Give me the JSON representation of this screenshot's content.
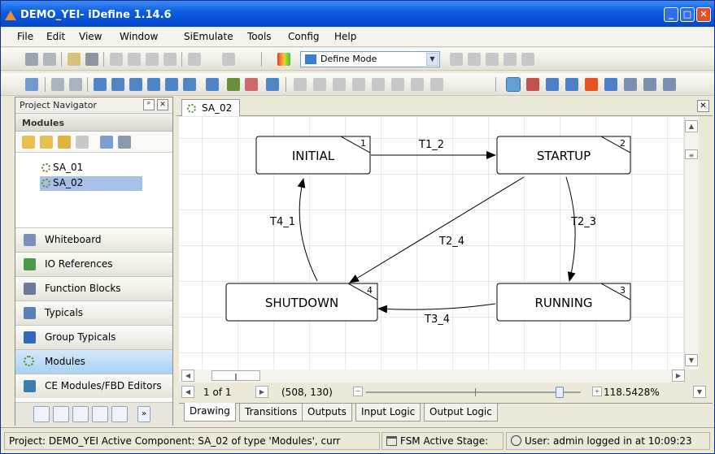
{
  "window": {
    "title": "DEMO_YEI- iDefine 1.14.6",
    "minimize": "_",
    "maximize": "□",
    "close": "✕"
  },
  "menu": [
    "File",
    "Edit",
    "View",
    "Window",
    "SiEmulate",
    "Tools",
    "Config",
    "Help"
  ],
  "toolbar": {
    "mode_value": "Define Mode"
  },
  "navigator": {
    "title": "Project Navigator",
    "pin": "ᵖ",
    "close": "✕",
    "modules_header": "Modules",
    "tree": [
      {
        "label": "SA_01",
        "selected": false
      },
      {
        "label": "SA_02",
        "selected": true
      }
    ],
    "sections": [
      {
        "label": "Whiteboard",
        "icon": "whiteboard-icon",
        "color": "#7b8fb8",
        "active": false
      },
      {
        "label": "IO References",
        "icon": "io-references-icon",
        "color": "#4a9a4a",
        "active": false
      },
      {
        "label": "Function Blocks",
        "icon": "function-blocks-icon",
        "color": "#6a7a98",
        "active": false
      },
      {
        "label": "Typicals",
        "icon": "typicals-icon",
        "color": "#5c7fb5",
        "active": false
      },
      {
        "label": "Group Typicals",
        "icon": "group-typicals-icon",
        "color": "#2f6bb8",
        "active": false
      },
      {
        "label": "Modules",
        "icon": "modules-icon",
        "color": "#5a8a2a",
        "active": true
      },
      {
        "label": "CE Modules/FBD Editors",
        "icon": "ce-modules-icon",
        "color": "#3a7fb0",
        "active": false
      }
    ],
    "more": "»"
  },
  "editor": {
    "tab_label": "SA_02",
    "close": "✕",
    "states": [
      {
        "name": "INITIAL",
        "num": "1"
      },
      {
        "name": "STARTUP",
        "num": "2"
      },
      {
        "name": "RUNNING",
        "num": "3"
      },
      {
        "name": "SHUTDOWN",
        "num": "4"
      }
    ],
    "transitions": {
      "t1_2": "T1_2",
      "t2_3": "T2_3",
      "t2_4": "T2_4",
      "t3_4": "T3_4",
      "t4_1": "T4_1"
    },
    "page": "1 of 1",
    "coords": "(508, 130)",
    "zoom_percent": "118.5428%",
    "zoom_level": 0.9,
    "bottom_tabs": [
      {
        "label": "Drawing",
        "active": true
      },
      {
        "label": "Transitions",
        "active": false
      },
      {
        "label": "Outputs",
        "active": false
      },
      {
        "label": "Input Logic",
        "active": false
      },
      {
        "label": "Output Logic",
        "active": false
      }
    ]
  },
  "status": {
    "project": "Project: DEMO_YEI  Active Component: SA_02 of type 'Modules', curr",
    "fsm": "FSM Active Stage:",
    "user": "User: admin logged in at 10:09:23"
  }
}
